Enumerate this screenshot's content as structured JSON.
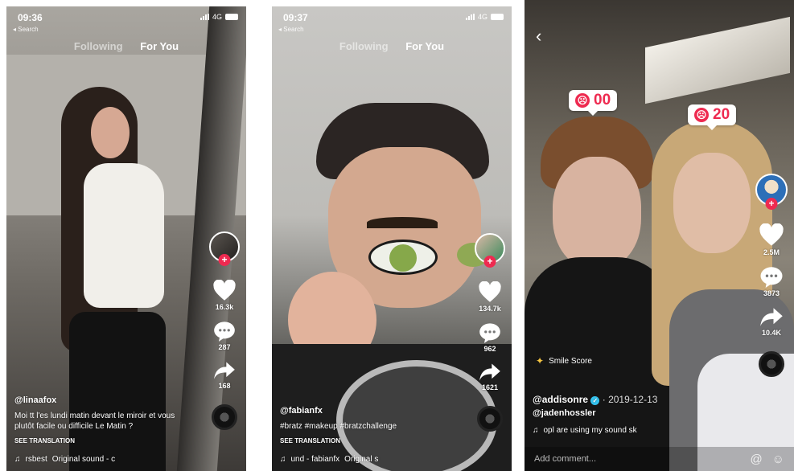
{
  "phone1": {
    "time": "09:36",
    "back_label": "◂ Search",
    "network": "4G",
    "tabs": [
      "Following",
      "For You"
    ],
    "likes": "16.3k",
    "comments": "287",
    "shares": "168",
    "username": "@linaafox",
    "description": "Moi tt l'es lundi matin devant le miroir et vous plutôt facile ou difficile Le Matin ?",
    "see_translation": "SEE TRANSLATION",
    "sound_left": "rsbest",
    "sound_right": "Original sound - c"
  },
  "phone2": {
    "time": "09:37",
    "back_label": "◂ Search",
    "network": "4G",
    "tabs": [
      "Following",
      "For You"
    ],
    "likes": "134.7k",
    "comments": "962",
    "shares": "1621",
    "username": "@fabianfx",
    "description": "#bratz #makeup #bratzchallenge",
    "see_translation": "SEE TRANSLATION",
    "sound_left": "und - fabianfx",
    "sound_right": "Original s"
  },
  "phone3": {
    "score_left": "00",
    "score_right": "20",
    "effect": "Smile Score",
    "likes": "2.5M",
    "comments": "3873",
    "shares": "10.4K",
    "username": "@addisonre",
    "date": "· 2019-12-13",
    "mention": "@jadenhossler",
    "sound": "opl are using my sound sk",
    "comment_placeholder": "Add comment..."
  }
}
